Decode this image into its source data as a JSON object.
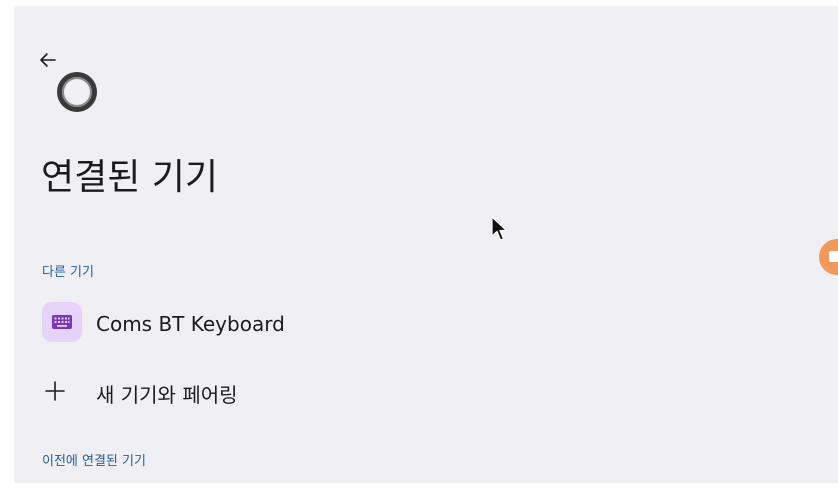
{
  "page": {
    "title": "연결된 기기",
    "back_icon": "arrow-left-icon",
    "header_icon": "ring-icon"
  },
  "sections": {
    "other_devices": {
      "header": "다른 기기",
      "devices": [
        {
          "label": "Coms BT Keyboard",
          "icon": "keyboard-icon"
        }
      ],
      "pair_new": {
        "label": "새 기기와 페어링",
        "icon": "plus-icon"
      }
    },
    "previous_devices": {
      "header": "이전에 연결된 기기"
    }
  },
  "colors": {
    "background": "#f0eff4",
    "section_header": "#1f5f99",
    "device_icon_bg": "#e6d3fa",
    "device_icon_fg": "#7a35c0",
    "edge_badge": "#f0995a"
  }
}
